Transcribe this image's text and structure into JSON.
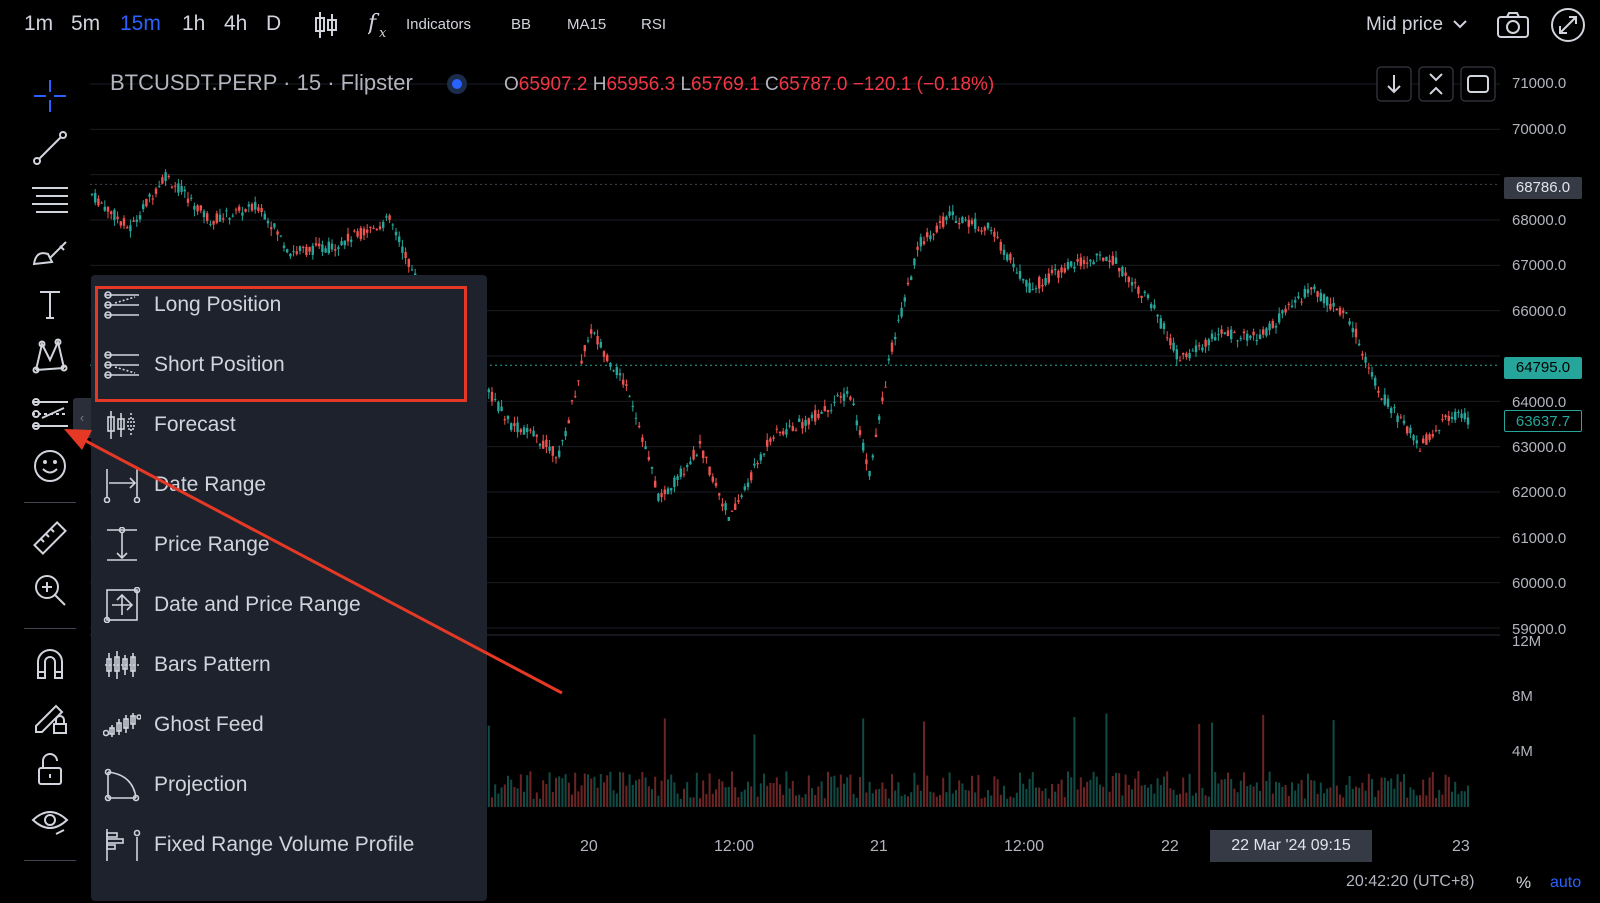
{
  "timeframes": [
    {
      "label": "1m",
      "active": false
    },
    {
      "label": "5m",
      "active": false
    },
    {
      "label": "15m",
      "active": true
    },
    {
      "label": "1h",
      "active": false
    },
    {
      "label": "4h",
      "active": false
    },
    {
      "label": "D",
      "active": false
    }
  ],
  "toolbar": {
    "indicators_label": "Indicators",
    "studies": [
      "BB",
      "MA15",
      "RSI"
    ],
    "price_source": "Mid price"
  },
  "legend": {
    "symbol": "BTCUSDT.PERP · 15 · Flipster",
    "o_key": "O",
    "o_val": "65907.2",
    "h_key": "H",
    "h_val": "65956.3",
    "l_key": "L",
    "l_val": "65769.1",
    "c_key": "C",
    "c_val": "65787.0",
    "change": "−120.1 (−0.18%)"
  },
  "price_scale": {
    "labels": [
      "71000.0",
      "70000.0",
      "68000.0",
      "67000.0",
      "66000.0",
      "64000.0",
      "63000.0",
      "62000.0",
      "61000.0",
      "60000.0",
      "59000.0"
    ],
    "badge_high": "68786.0",
    "badge_line": "64795.0",
    "badge_last": "63637.7",
    "volume_labels": [
      "12M",
      "8M",
      "4M"
    ]
  },
  "time_scale": {
    "labels": [
      "20",
      "12:00",
      "21",
      "12:00",
      "22",
      "23"
    ],
    "crosshair": "22 Mar '24   09:15",
    "clock": "20:42:20 (UTC+8)",
    "percent_label": "%",
    "auto_label": "auto"
  },
  "menu": {
    "items": [
      {
        "label": "Long Position",
        "icon": "long-position-icon"
      },
      {
        "label": "Short Position",
        "icon": "short-position-icon"
      },
      {
        "label": "Forecast",
        "icon": "forecast-icon"
      },
      {
        "label": "Date Range",
        "icon": "date-range-icon"
      },
      {
        "label": "Price Range",
        "icon": "price-range-icon"
      },
      {
        "label": "Date and Price Range",
        "icon": "date-price-range-icon"
      },
      {
        "label": "Bars Pattern",
        "icon": "bars-pattern-icon"
      },
      {
        "label": "Ghost Feed",
        "icon": "ghost-feed-icon"
      },
      {
        "label": "Projection",
        "icon": "projection-icon"
      },
      {
        "label": "Fixed Range Volume Profile",
        "icon": "fixed-range-volume-profile-icon"
      }
    ]
  },
  "colors": {
    "up": "#26a69a",
    "down": "#ef5350",
    "accent": "#2962ff",
    "annotation": "#e53925",
    "menu_bg": "#1e222d"
  }
}
